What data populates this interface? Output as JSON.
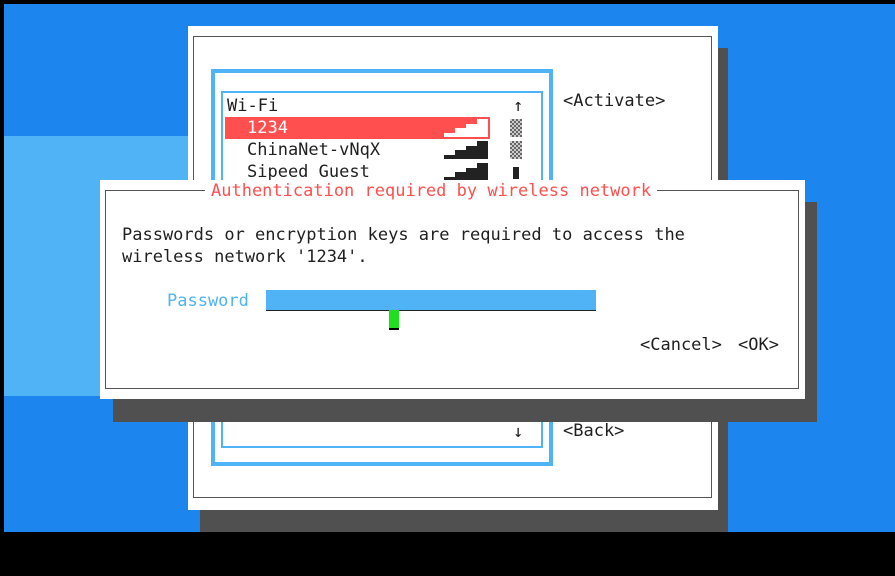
{
  "wifi_window": {
    "list_title": "Wi-Fi",
    "scroll_up": "↑",
    "scroll_down": "↓",
    "networks": [
      {
        "ssid": "1234",
        "signal_level": 0.75,
        "secured": true,
        "selected": true
      },
      {
        "ssid": "ChinaNet-vNqX",
        "signal_level": 1.0,
        "secured": true,
        "selected": false
      },
      {
        "ssid": "Sipeed_Guest",
        "signal_level": 1.0,
        "secured": false,
        "selected": false
      }
    ],
    "activate_label": "<Activate>",
    "back_label": "<Back>"
  },
  "auth_dialog": {
    "title": "Authentication required by wireless network",
    "message_line1": "Passwords or encryption keys are required to access the",
    "message_line2": "wireless network '1234'.",
    "password_label": "Password",
    "password_value": "********",
    "cancel_label": "<Cancel>",
    "ok_label": "<OK>"
  },
  "colors": {
    "desktop": "#1c86ee",
    "accent": "#4fb3f5",
    "selection": "#ff4f4f",
    "cursor": "#1fe01f"
  }
}
